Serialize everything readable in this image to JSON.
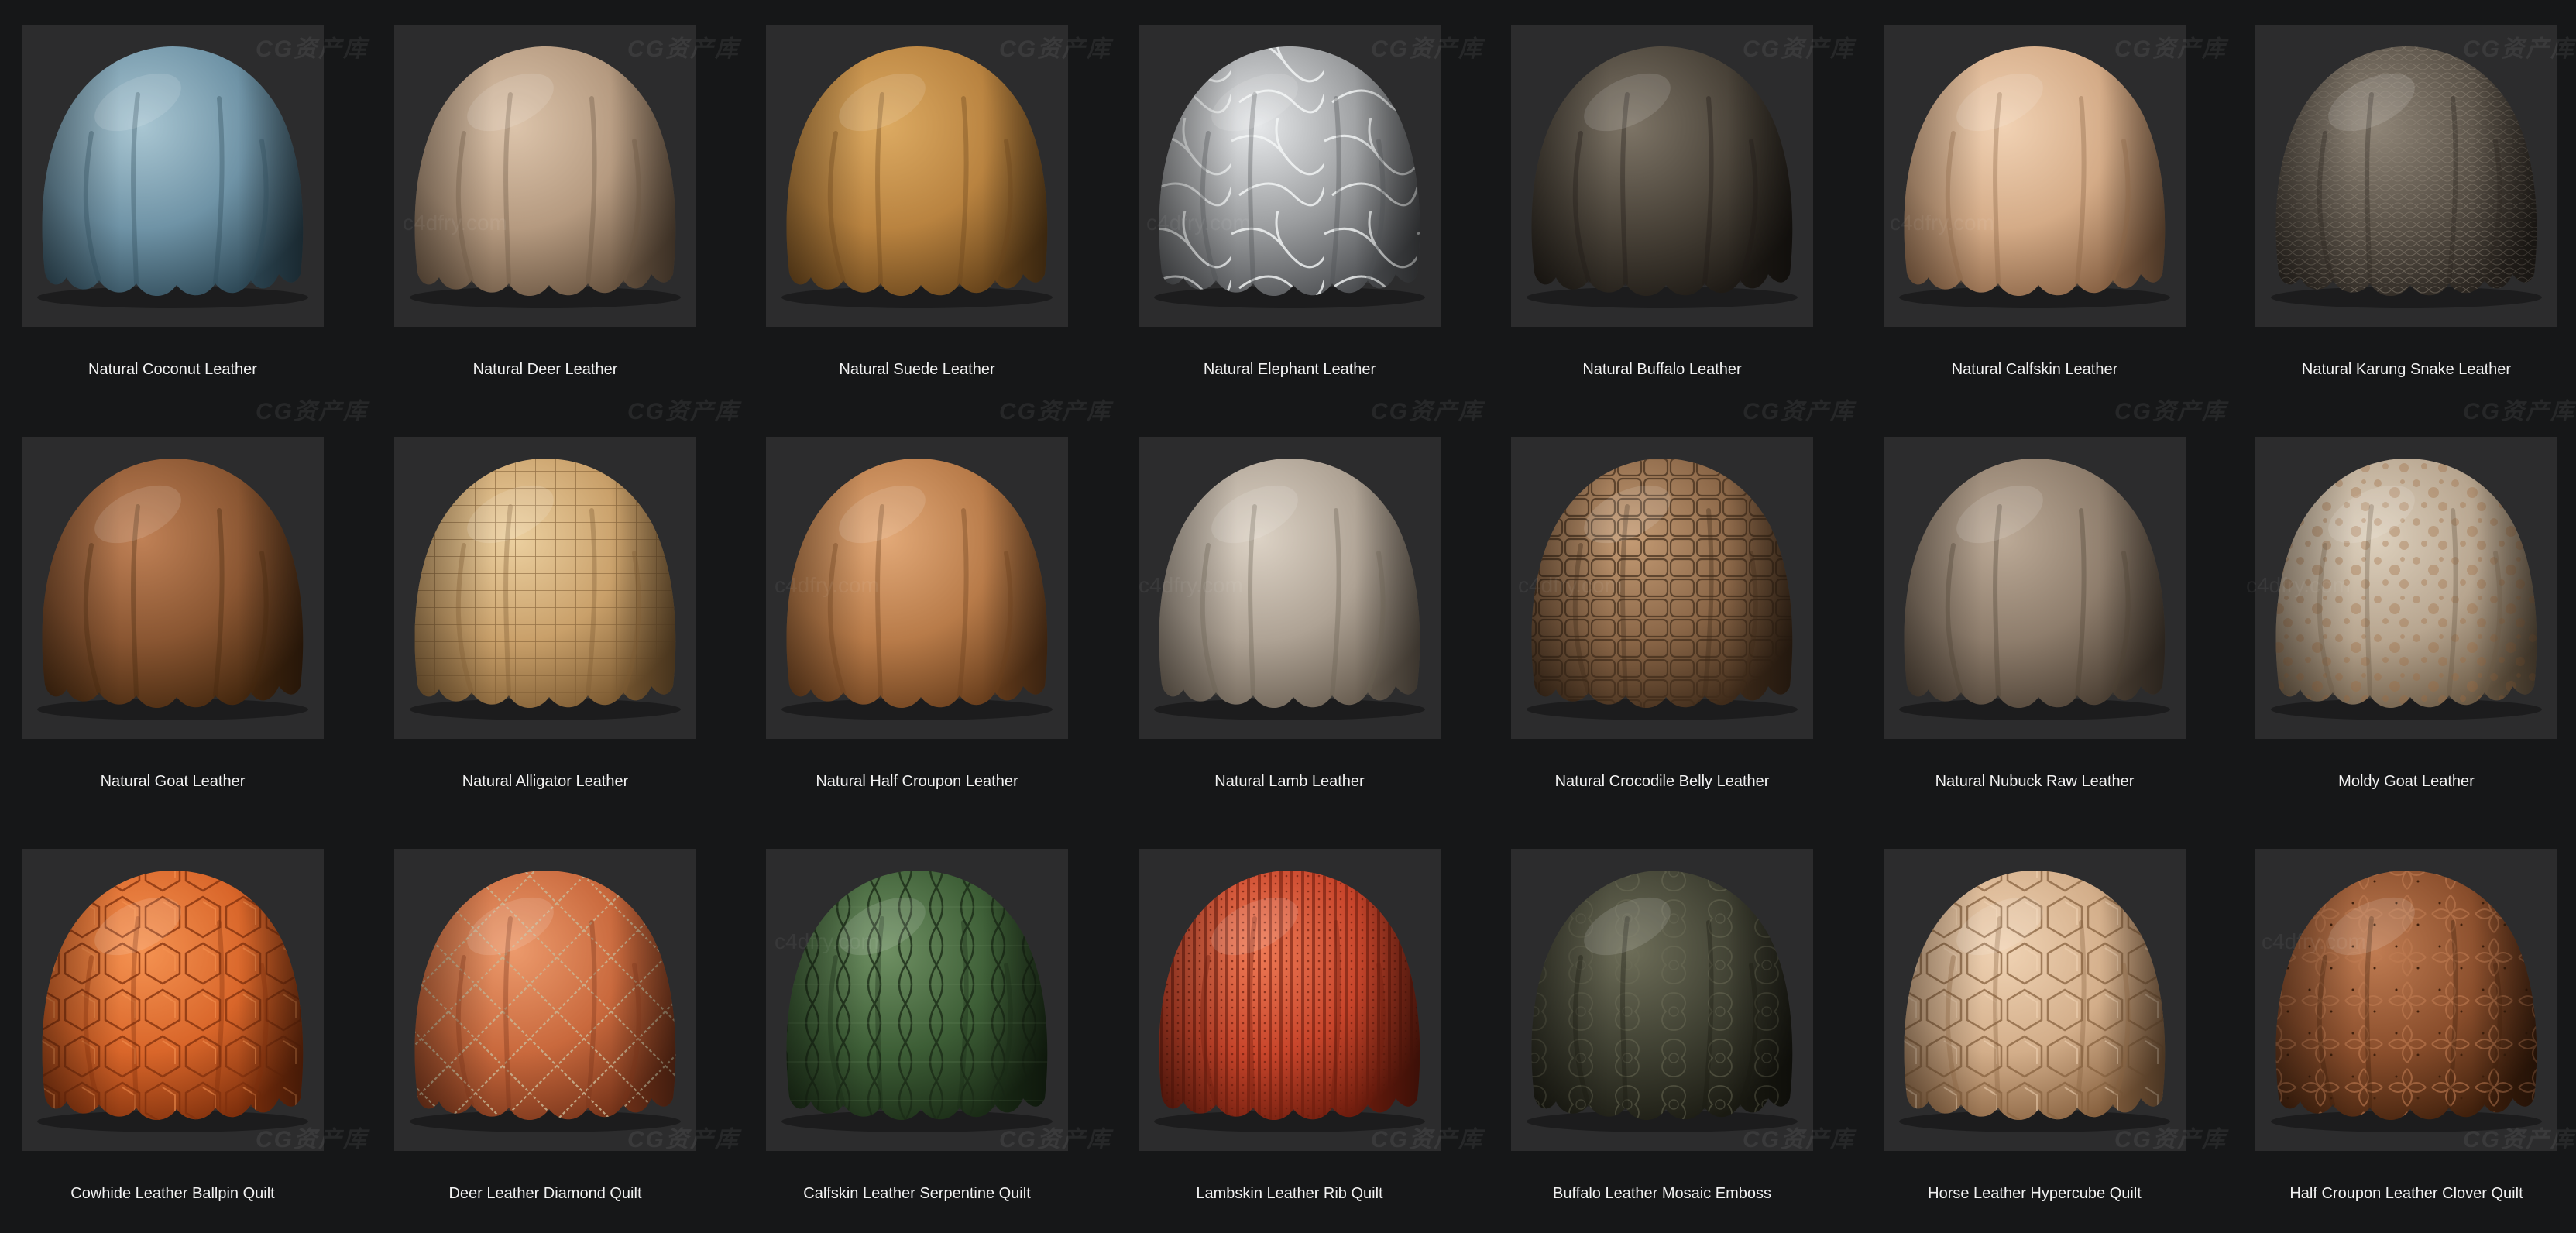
{
  "watermarks": {
    "brand": "CG资产库",
    "site": "c4dfry.com"
  },
  "materials": [
    {
      "label": "Natural Coconut Leather",
      "icon": "drape-blue-leather",
      "base": "#6f93a6",
      "light": "#a9c6d2",
      "dark": "#2f4a58",
      "pattern": "none"
    },
    {
      "label": "Natural Deer Leather",
      "icon": "drape-tan-leather",
      "base": "#b59a80",
      "light": "#dcc4ab",
      "dark": "#6b5642",
      "pattern": "none"
    },
    {
      "label": "Natural Suede Leather",
      "icon": "drape-ochre-suede",
      "base": "#b98340",
      "light": "#dcaa62",
      "dark": "#6a461c",
      "pattern": "none"
    },
    {
      "label": "Natural Elephant Leather",
      "icon": "drape-grey-elephant",
      "base": "#9a9c9e",
      "light": "#e6e8ea",
      "dark": "#4d4f52",
      "pattern": "veins"
    },
    {
      "label": "Natural Buffalo Leather",
      "icon": "drape-dark-buffalo",
      "base": "#4a4339",
      "light": "#7d7466",
      "dark": "#1f1b16",
      "pattern": "none"
    },
    {
      "label": "Natural Calfskin Leather",
      "icon": "drape-peach-calfskin",
      "base": "#d4ab87",
      "light": "#f1d2b4",
      "dark": "#8a6446",
      "pattern": "none"
    },
    {
      "label": "Natural Karung Snake Leather",
      "icon": "drape-snake-scales",
      "base": "#5a5248",
      "light": "#8f8577",
      "dark": "#2a2520",
      "pattern": "scales"
    },
    {
      "label": "Natural Goat Leather",
      "icon": "drape-brown-goat",
      "base": "#8a5632",
      "light": "#c08156",
      "dark": "#45280f",
      "pattern": "none"
    },
    {
      "label": "Natural Alligator Leather",
      "icon": "drape-alligator-grid",
      "base": "#c9a06a",
      "light": "#ecd0a0",
      "dark": "#7e5c33",
      "pattern": "grid"
    },
    {
      "label": "Natural Half Croupon Leather",
      "icon": "drape-orange-croupon",
      "base": "#b87b49",
      "light": "#e2a978",
      "dark": "#6a3f1d",
      "pattern": "none"
    },
    {
      "label": "Natural Lamb Leather",
      "icon": "drape-beige-lamb",
      "base": "#aea294",
      "light": "#dcd2c5",
      "dark": "#6b6053",
      "pattern": "none"
    },
    {
      "label": "Natural Crocodile Belly Leather",
      "icon": "drape-croc-belly",
      "base": "#8a6647",
      "light": "#c49b74",
      "dark": "#3f2b1a",
      "pattern": "croc"
    },
    {
      "label": "Natural Nubuck Raw Leather",
      "icon": "drape-nubuck",
      "base": "#8e7d6c",
      "light": "#bcaa97",
      "dark": "#4d4135",
      "pattern": "none"
    },
    {
      "label": "Moldy Goat Leather",
      "icon": "drape-moldy-goat",
      "base": "#b7a58f",
      "light": "#ddd0bd",
      "dark": "#6b5a45",
      "pattern": "speckle"
    },
    {
      "label": "Cowhide Leather Ballpin Quilt",
      "icon": "drape-orange-hex-quilt",
      "base": "#d9662a",
      "light": "#f59352",
      "dark": "#7e2f0c",
      "pattern": "hex"
    },
    {
      "label": "Deer Leather Diamond Quilt",
      "icon": "drape-diamond-quilt",
      "base": "#c9693d",
      "light": "#ec9a6c",
      "dark": "#77341a",
      "pattern": "diamond"
    },
    {
      "label": "Calfskin Leather Serpentine Quilt",
      "icon": "drape-green-serpentine",
      "base": "#3d5e36",
      "light": "#6f9063",
      "dark": "#1a2b16",
      "pattern": "serpentine"
    },
    {
      "label": "Lambskin Leather Rib Quilt",
      "icon": "drape-red-rib-quilt",
      "base": "#c8452b",
      "light": "#ee7a55",
      "dark": "#6d1c0d",
      "pattern": "rib"
    },
    {
      "label": "Buffalo Leather Mosaic Emboss",
      "icon": "drape-mosaic-emboss",
      "base": "#3f4032",
      "light": "#6d6d58",
      "dark": "#1a1a12",
      "pattern": "mosaic"
    },
    {
      "label": "Horse Leather Hypercube Quilt",
      "icon": "drape-hypercube-quilt",
      "base": "#d3ae8a",
      "light": "#f0d3b4",
      "dark": "#87613f",
      "pattern": "hex"
    },
    {
      "label": "Half Croupon Leather Clover Quilt",
      "icon": "drape-clover-quilt",
      "base": "#8a4e2c",
      "light": "#c07c52",
      "dark": "#40200c",
      "pattern": "clover"
    }
  ]
}
